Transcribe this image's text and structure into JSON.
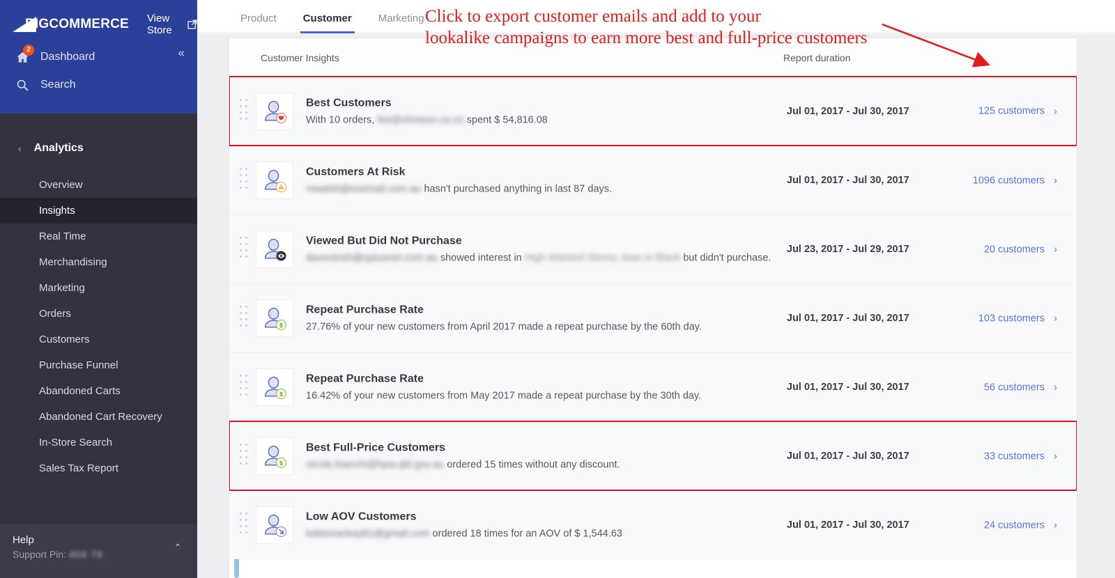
{
  "sidebar": {
    "brand": {
      "prefix": "BIG",
      "suffix": "COMMERCE"
    },
    "view_store": "View Store",
    "primary": [
      {
        "label": "Dashboard",
        "icon": "home-icon",
        "badge": "2"
      },
      {
        "label": "Search",
        "icon": "search-icon",
        "badge": ""
      }
    ],
    "collapse_icon": "«",
    "section": {
      "label": "Analytics",
      "back_icon": "‹"
    },
    "items": [
      {
        "label": "Overview",
        "active": false
      },
      {
        "label": "Insights",
        "active": true
      },
      {
        "label": "Real Time",
        "active": false
      },
      {
        "label": "Merchandising",
        "active": false
      },
      {
        "label": "Marketing",
        "active": false
      },
      {
        "label": "Orders",
        "active": false
      },
      {
        "label": "Customers",
        "active": false
      },
      {
        "label": "Purchase Funnel",
        "active": false
      },
      {
        "label": "Abandoned Carts",
        "active": false
      },
      {
        "label": "Abandoned Cart Recovery",
        "active": false
      },
      {
        "label": "In-Store Search",
        "active": false
      },
      {
        "label": "Sales Tax Report",
        "active": false
      }
    ],
    "help": {
      "title": "Help",
      "pin_label": "Support Pin:",
      "pin_value": "404 79",
      "chevron": "⌃"
    }
  },
  "tabs": [
    {
      "label": "Product",
      "active": false
    },
    {
      "label": "Customer",
      "active": true
    },
    {
      "label": "Marketing",
      "active": false
    }
  ],
  "card": {
    "header_left": "Customer Insights",
    "header_right": "Report duration"
  },
  "annotation": {
    "line1": "Click to export customer emails and add to your",
    "line2": "lookalike campaigns to earn more best and full-price customers",
    "color": "#e41b1b"
  },
  "colors": {
    "brand_blue": "#2b4199",
    "sidebar_dark": "#343140",
    "accent_link": "#5b74e0",
    "highlight_red": "#e8141c",
    "tab_underline": "#4b63d8"
  },
  "rows": [
    {
      "title": "Best Customers",
      "desc_pre": "With 10 orders,",
      "email": "fee@shineon.co.nz",
      "desc_post": "spent $ 54,816.08",
      "extra_blur": "",
      "desc_tail": "",
      "date": "Jul 01, 2017 - Jul 30, 2017",
      "link": "125 customers",
      "badge": "heart",
      "highlight": true
    },
    {
      "title": "Customers At Risk",
      "desc_pre": "",
      "email": "mwalsh@exemail.com.au",
      "desc_post": "hasn't purchased anything in last 87 days.",
      "extra_blur": "",
      "desc_tail": "",
      "date": "Jul 01, 2017 - Jul 30, 2017",
      "link": "1096 customers",
      "badge": "warning",
      "highlight": false
    },
    {
      "title": "Viewed But Did Not Purchase",
      "desc_pre": "",
      "email": "daventrish@optusnet.com.au",
      "desc_post": "showed interest in",
      "extra_blur": "High Waisted Skinny Jean in Black",
      "desc_tail": "but didn't purchase.",
      "date": "Jul 23, 2017 - Jul 29, 2017",
      "link": "20 customers",
      "badge": "eye",
      "highlight": false
    },
    {
      "title": "Repeat Purchase Rate",
      "desc_pre": "27.76% of your new customers from April 2017 made a repeat purchase by the 60th day.",
      "email": "",
      "desc_post": "",
      "extra_blur": "",
      "desc_tail": "",
      "date": "Jul 01, 2017 - Jul 30, 2017",
      "link": "103 customers",
      "badge": "dollar",
      "highlight": false
    },
    {
      "title": "Repeat Purchase Rate",
      "desc_pre": "16.42% of your new customers from May 2017 made a repeat purchase by the 30th day.",
      "email": "",
      "desc_post": "",
      "extra_blur": "",
      "desc_tail": "",
      "date": "Jul 01, 2017 - Jul 30, 2017",
      "link": "56 customers",
      "badge": "dollar",
      "highlight": false
    },
    {
      "title": "Best Full-Price Customers",
      "desc_pre": "",
      "email": "nicole.bianchi@hpw.qld.gov.au",
      "desc_post": "ordered 15 times without any discount.",
      "extra_blur": "",
      "desc_tail": "",
      "date": "Jul 01, 2017 - Jul 30, 2017",
      "link": "33 customers",
      "badge": "dollar",
      "highlight": true
    },
    {
      "title": "Low AOV Customers",
      "desc_pre": "",
      "email": "katiemackay81@gmail.com",
      "desc_post": "ordered 18 times for an AOV of $ 1,544.63",
      "extra_blur": "",
      "desc_tail": "",
      "date": "Jul 01, 2017 - Jul 30, 2017",
      "link": "24 customers",
      "badge": "down",
      "highlight": false
    }
  ]
}
